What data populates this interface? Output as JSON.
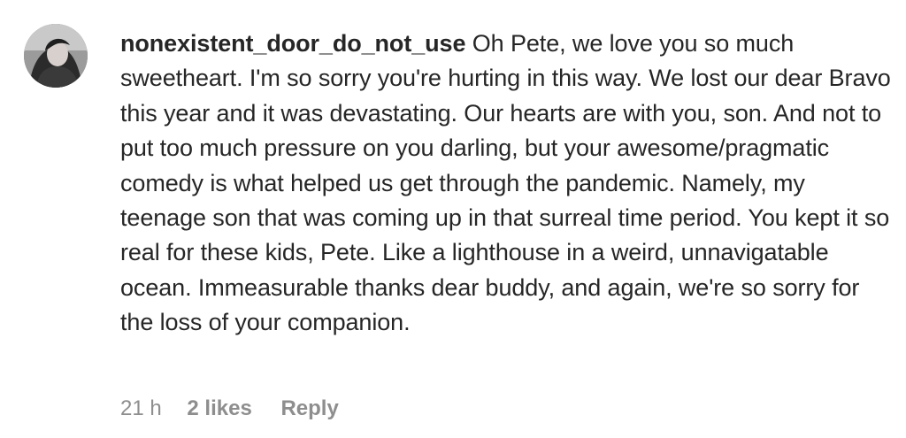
{
  "comment": {
    "username": "nonexistent_door_do_not_use",
    "text": "Oh Pete, we love you so much sweetheart. I'm so sorry you're hurting in this way. We lost our dear Bravo this year and it was devastating. Our hearts are with you, son. And not to put too much pressure on you darling, but your awesome/pragmatic comedy is what helped us get through the pandemic. Namely, my teenage son that was coming up in that surreal time period. You kept it so real for these kids, Pete. Like a lighthouse in a weird, unnavigatable ocean. Immeasurable thanks dear buddy, and again, we're so sorry for the loss of your companion.",
    "timestamp": "21 h",
    "likes": "2 likes",
    "reply_label": "Reply",
    "avatar_icon": "user-avatar-photo"
  }
}
